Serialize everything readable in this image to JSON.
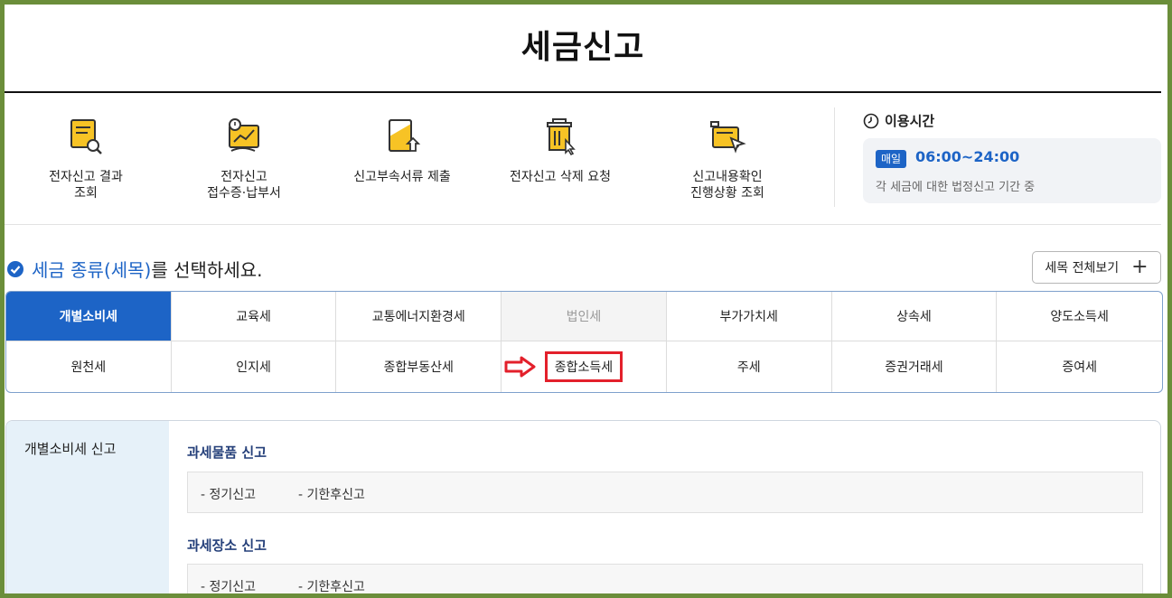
{
  "page": {
    "title": "세금신고"
  },
  "quick_menu": [
    {
      "label": "전자신고 결과\n조회",
      "icon": "document-search-icon"
    },
    {
      "label": "전자신고\n접수증·납부서",
      "icon": "receipt-chart-icon"
    },
    {
      "label": "신고부속서류 제출",
      "icon": "document-upload-icon"
    },
    {
      "label": "전자신고 삭제 요청",
      "icon": "trash-click-icon"
    },
    {
      "label": "신고내용확인\n진행상황 조회",
      "icon": "document-send-icon"
    }
  ],
  "hours": {
    "title": "이용시간",
    "badge": "매일",
    "time": "06:00~24:00",
    "desc": "각 세금에 대한 법정신고 기간 중"
  },
  "select": {
    "highlight": "세금 종류(세목)",
    "rest": "를 선택하세요.",
    "view_all": "세목 전체보기"
  },
  "tax_types": {
    "row1": [
      "개별소비세",
      "교육세",
      "교통에너지환경세",
      "법인세",
      "부가가치세",
      "상속세",
      "양도소득세"
    ],
    "row2": [
      "원천세",
      "인지세",
      "종합부동산세",
      "종합소득세",
      "주세",
      "증권거래세",
      "증여세"
    ],
    "active": "개별소비세",
    "disabled": "법인세",
    "marked": "종합소득세"
  },
  "detail": {
    "side_title": "개별소비세 신고",
    "sections": [
      {
        "title": "과세물품 신고",
        "options": [
          "- 정기신고",
          "- 기한후신고"
        ]
      },
      {
        "title": "과세장소 신고",
        "options": [
          "- 정기신고",
          "- 기한후신고"
        ]
      }
    ]
  },
  "colors": {
    "accent": "#1d64c6",
    "highlight_box": "#e3202b",
    "frame": "#6b8e3a"
  }
}
